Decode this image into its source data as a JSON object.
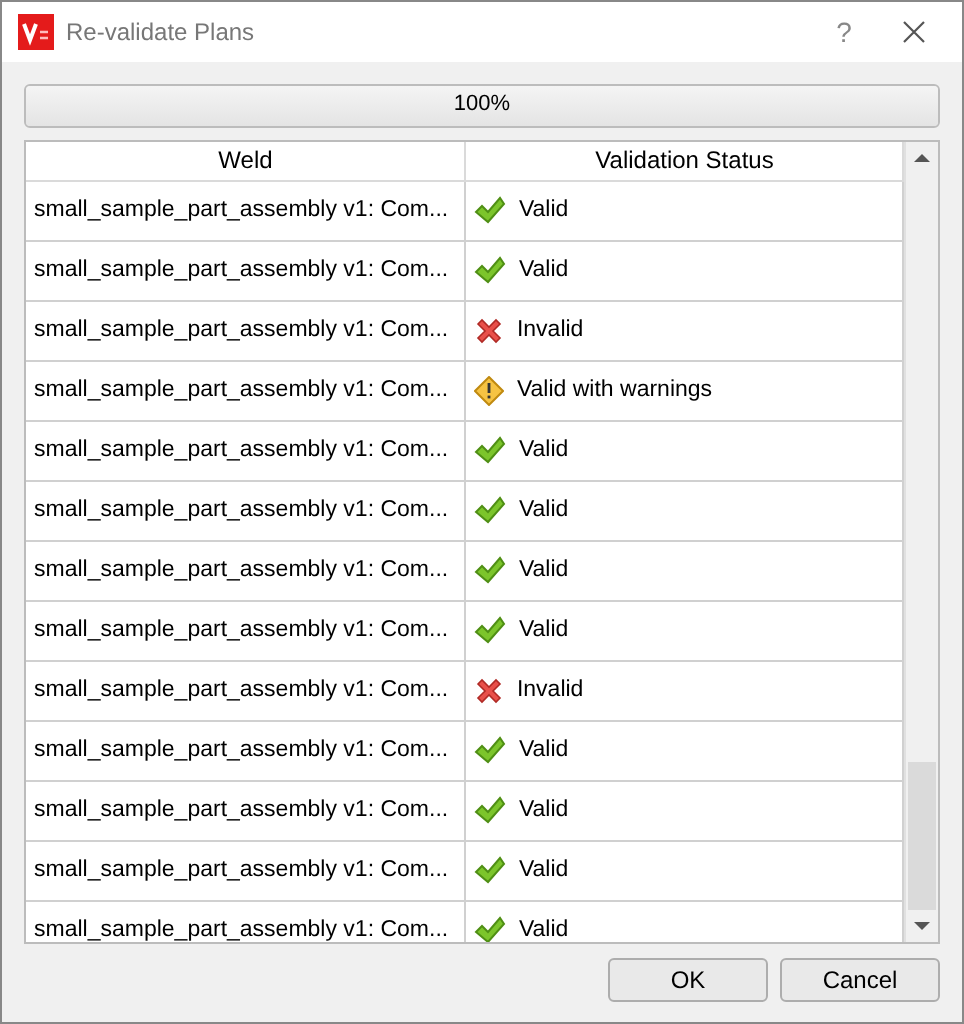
{
  "window": {
    "title": "Re-validate Plans",
    "help": "?"
  },
  "progress": {
    "level": 1,
    "reading": "100%"
  },
  "table": {
    "columns": [
      "Weld",
      "Validation Status"
    ],
    "rows": [
      {
        "weld": "small_sample_part_assembly v1: Com...",
        "status": "Valid",
        "kind": "valid"
      },
      {
        "weld": "small_sample_part_assembly v1: Com...",
        "status": "Valid",
        "kind": "valid"
      },
      {
        "weld": "small_sample_part_assembly v1: Com...",
        "status": "Invalid",
        "kind": "invalid"
      },
      {
        "weld": "small_sample_part_assembly v1: Com...",
        "status": "Valid with warnings",
        "kind": "warning"
      },
      {
        "weld": "small_sample_part_assembly v1: Com...",
        "status": "Valid",
        "kind": "valid"
      },
      {
        "weld": "small_sample_part_assembly v1: Com...",
        "status": "Valid",
        "kind": "valid"
      },
      {
        "weld": "small_sample_part_assembly v1: Com...",
        "status": "Valid",
        "kind": "valid"
      },
      {
        "weld": "small_sample_part_assembly v1: Com...",
        "status": "Valid",
        "kind": "valid"
      },
      {
        "weld": "small_sample_part_assembly v1: Com...",
        "status": "Invalid",
        "kind": "invalid"
      },
      {
        "weld": "small_sample_part_assembly v1: Com...",
        "status": "Valid",
        "kind": "valid"
      },
      {
        "weld": "small_sample_part_assembly v1: Com...",
        "status": "Valid",
        "kind": "valid"
      },
      {
        "weld": "small_sample_part_assembly v1: Com...",
        "status": "Valid",
        "kind": "valid"
      },
      {
        "weld": "small_sample_part_assembly v1: Com...",
        "status": "Valid",
        "kind": "valid"
      }
    ]
  },
  "buttons": [
    "OK",
    "Cancel"
  ]
}
